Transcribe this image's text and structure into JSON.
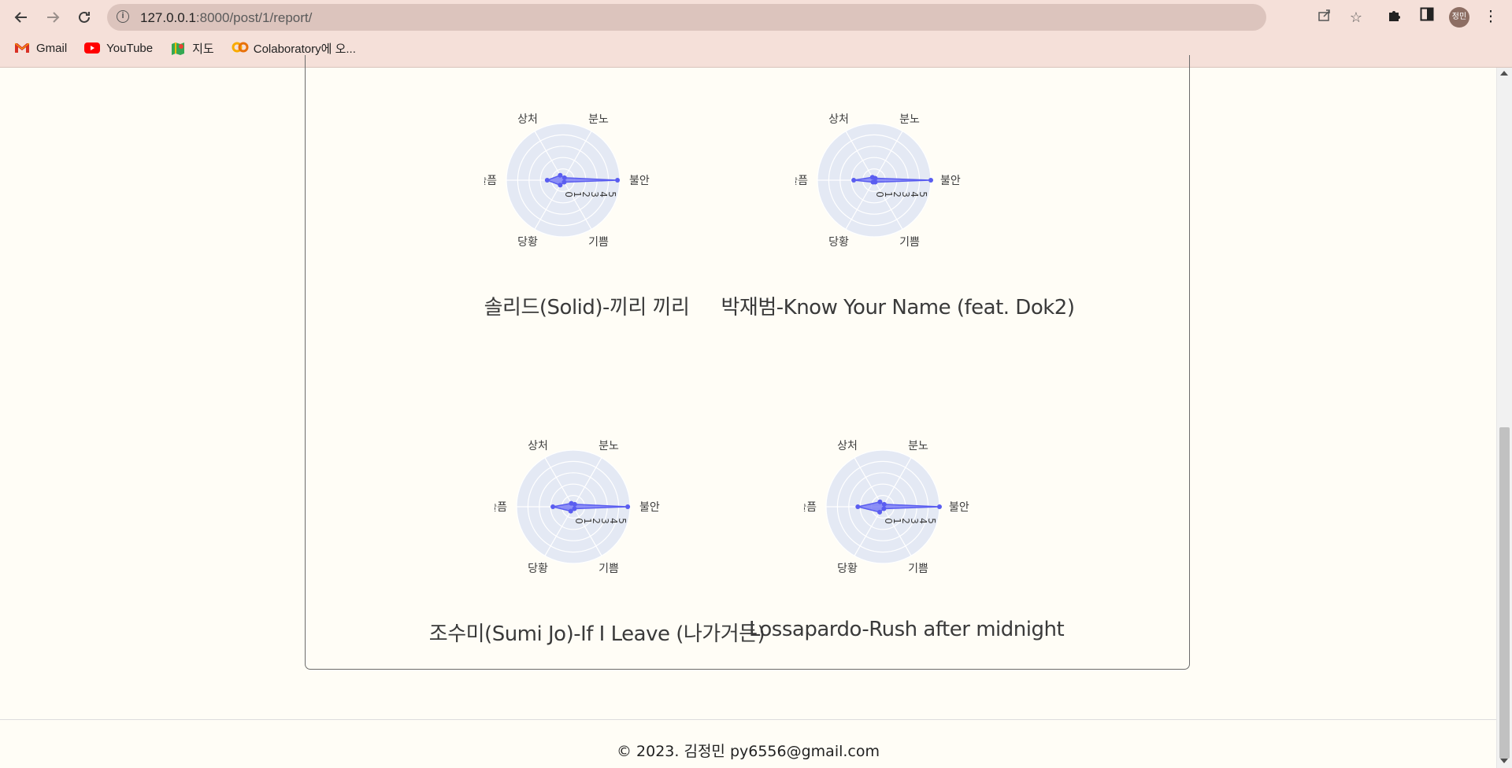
{
  "browser": {
    "url_host": "127.0.0.1",
    "url_path": ":8000/post/1/report/",
    "avatar_text": "정민",
    "bookmarks": [
      {
        "label": "Gmail",
        "icon": "gmail-icon"
      },
      {
        "label": "YouTube",
        "icon": "youtube-icon"
      },
      {
        "label": "지도",
        "icon": "maps-icon"
      },
      {
        "label": "Colaboratory에 오...",
        "icon": "colab-icon"
      }
    ]
  },
  "charts_section": {
    "axis_labels": [
      "상처",
      "분노",
      "불안",
      "기쁨",
      "당황",
      "슬픔"
    ],
    "tick_labels": [
      "0",
      "1",
      "2",
      "3",
      "4",
      "5"
    ],
    "colors": {
      "fill": "#6b6ef5",
      "stroke": "#5a5df0",
      "bg": "#e4e9f4",
      "grid": "#ffffff"
    }
  },
  "chart_data": [
    {
      "type": "radar",
      "title": "솔리드(Solid)-끼리 끼리",
      "axes": [
        "상처",
        "분노",
        "불안",
        "기쁨",
        "당황",
        "슬픔"
      ],
      "values": [
        0.5,
        0.25,
        4.8,
        0.2,
        0.5,
        1.4
      ],
      "rlim": [
        0,
        5
      ]
    },
    {
      "type": "radar",
      "title": "박재범-Know Your Name (feat. Dok2)",
      "axes": [
        "상처",
        "분노",
        "불안",
        "기쁨",
        "당황",
        "슬픔"
      ],
      "values": [
        0.3,
        0.2,
        5.0,
        0.2,
        0.2,
        1.8
      ],
      "rlim": [
        0,
        5
      ]
    },
    {
      "type": "radar",
      "title": "조수미(Sumi Jo)-If I Leave (나가거든)",
      "axes": [
        "상처",
        "분노",
        "불안",
        "기쁨",
        "당황",
        "슬픔"
      ],
      "values": [
        0.35,
        0.25,
        4.8,
        0.2,
        0.45,
        1.8
      ],
      "rlim": [
        0,
        5
      ]
    },
    {
      "type": "radar",
      "title": "Lossapardo-Rush after midnight",
      "axes": [
        "상처",
        "분노",
        "불안",
        "기쁨",
        "당황",
        "슬픔"
      ],
      "values": [
        0.5,
        0.25,
        5.0,
        0.2,
        0.55,
        2.2
      ],
      "rlim": [
        0,
        5
      ]
    }
  ],
  "footer": {
    "text": "© 2023. 김정민 py6556@gmail.com"
  }
}
